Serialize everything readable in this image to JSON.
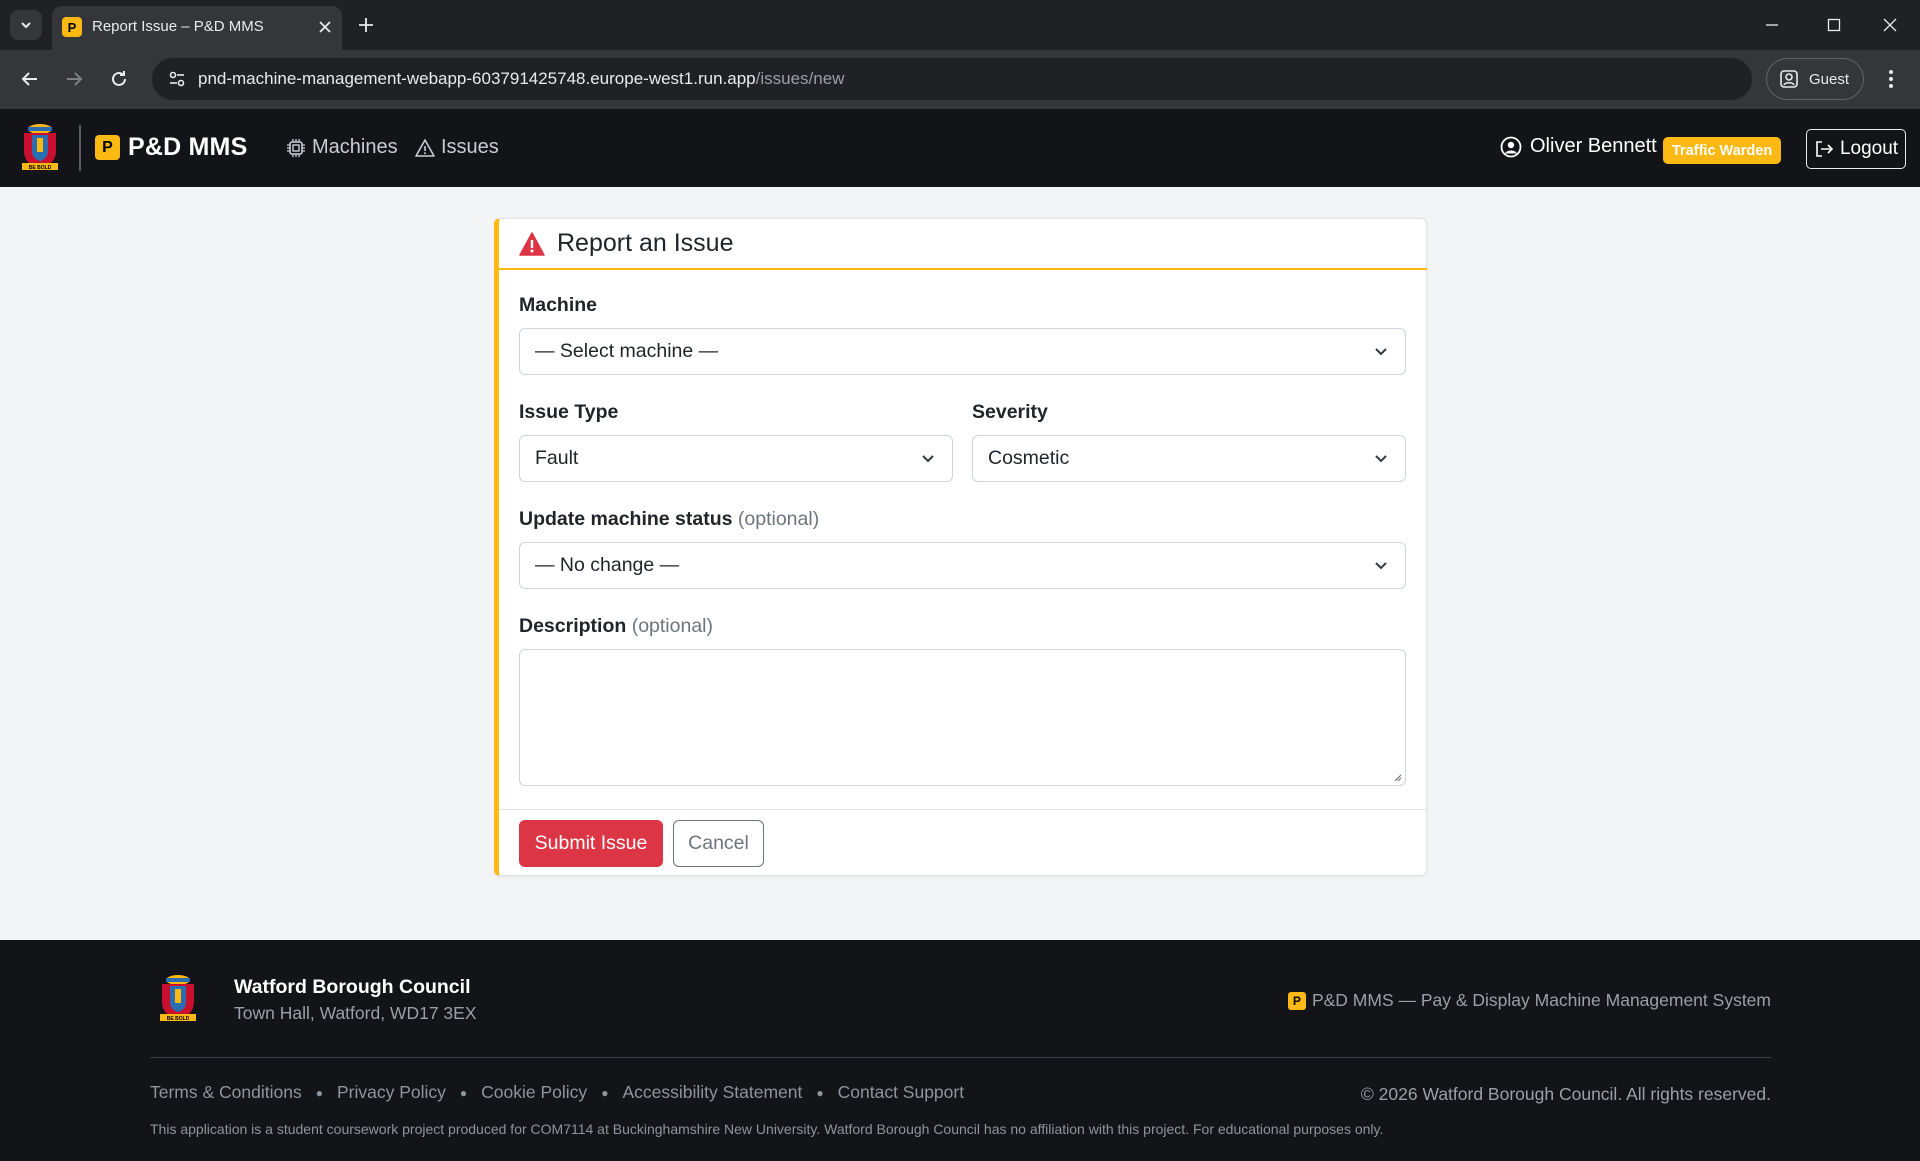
{
  "browser": {
    "tab_title": "Report Issue – P&D MMS",
    "favicon_letter": "P",
    "url_host": "pnd-machine-management-webapp-603791425748.europe-west1.run.app",
    "url_path": "/issues/new",
    "profile_label": "Guest"
  },
  "nav": {
    "brand_letter": "P",
    "brand_name": "P&D MMS",
    "links": [
      {
        "label": "Machines",
        "icon": "chip-icon"
      },
      {
        "label": "Issues",
        "icon": "warning-icon"
      }
    ],
    "user_name": "Oliver Bennett",
    "role_badge": "Traffic Warden",
    "logout_label": "Logout"
  },
  "form": {
    "title": "Report an Issue",
    "machine_label": "Machine",
    "machine_value": "— Select machine —",
    "issue_type_label": "Issue Type",
    "issue_type_value": "Fault",
    "severity_label": "Severity",
    "severity_value": "Cosmetic",
    "status_label": "Update machine status",
    "status_optional": "(optional)",
    "status_value": "— No change —",
    "description_label": "Description",
    "description_optional": "(optional)",
    "description_value": "",
    "submit_label": "Submit Issue",
    "cancel_label": "Cancel"
  },
  "footer": {
    "org_name": "Watford Borough Council",
    "address": "Town Hall, Watford, WD17 3EX",
    "app_letter": "P",
    "app_tagline": "P&D MMS — Pay & Display Machine Management System",
    "links": [
      "Terms & Conditions",
      "Privacy Policy",
      "Cookie Policy",
      "Accessibility Statement",
      "Contact Support"
    ],
    "copyright": "© 2026 Watford Borough Council. All rights reserved.",
    "disclaimer": "This application is a student coursework project produced for COM7114 at Buckinghamshire New University. Watford Borough Council has no affiliation with this project. For educational purposes only."
  },
  "colors": {
    "accent_yellow": "#fdb913",
    "danger_red": "#dc3545",
    "nav_dark": "#121417",
    "page_bg": "#f3f4f6"
  }
}
